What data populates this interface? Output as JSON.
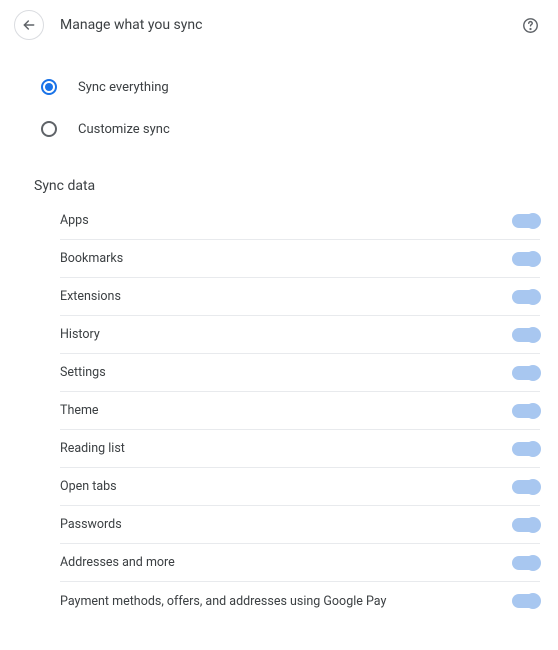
{
  "header": {
    "title": "Manage what you sync"
  },
  "radio": {
    "sync_everything": "Sync everything",
    "customize_sync": "Customize sync",
    "selected": "sync_everything"
  },
  "section": {
    "title": "Sync data"
  },
  "items": [
    {
      "label": "Apps",
      "on": true
    },
    {
      "label": "Bookmarks",
      "on": true
    },
    {
      "label": "Extensions",
      "on": true
    },
    {
      "label": "History",
      "on": true
    },
    {
      "label": "Settings",
      "on": true
    },
    {
      "label": "Theme",
      "on": true
    },
    {
      "label": "Reading list",
      "on": true
    },
    {
      "label": "Open tabs",
      "on": true
    },
    {
      "label": "Passwords",
      "on": true
    },
    {
      "label": "Addresses and more",
      "on": true
    },
    {
      "label": "Payment methods, offers, and addresses using Google Pay",
      "on": true
    }
  ]
}
